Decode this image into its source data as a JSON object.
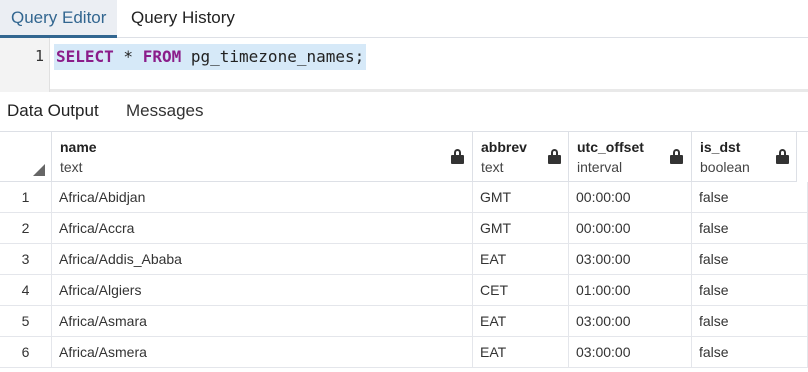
{
  "top_tabs": [
    {
      "label": "Query Editor",
      "active": true
    },
    {
      "label": "Query History",
      "active": false
    }
  ],
  "editor": {
    "line_number": "1",
    "tokens": [
      {
        "text": "SELECT",
        "kind": "keyword"
      },
      {
        "text": " * ",
        "kind": "plain"
      },
      {
        "text": "FROM",
        "kind": "keyword"
      },
      {
        "text": " pg_timezone_names;",
        "kind": "plain"
      }
    ]
  },
  "output_tabs": [
    {
      "label": "Data Output",
      "active": true
    },
    {
      "label": "Messages",
      "active": false
    }
  ],
  "grid": {
    "columns": [
      {
        "name": "name",
        "type": "text",
        "locked": true
      },
      {
        "name": "abbrev",
        "type": "text",
        "locked": true
      },
      {
        "name": "utc_offset",
        "type": "interval",
        "locked": true
      },
      {
        "name": "is_dst",
        "type": "boolean",
        "locked": true
      }
    ],
    "rows": [
      {
        "num": "1",
        "cells": [
          "Africa/Abidjan",
          "GMT",
          "00:00:00",
          "false"
        ]
      },
      {
        "num": "2",
        "cells": [
          "Africa/Accra",
          "GMT",
          "00:00:00",
          "false"
        ]
      },
      {
        "num": "3",
        "cells": [
          "Africa/Addis_Ababa",
          "EAT",
          "03:00:00",
          "false"
        ]
      },
      {
        "num": "4",
        "cells": [
          "Africa/Algiers",
          "CET",
          "01:00:00",
          "false"
        ]
      },
      {
        "num": "5",
        "cells": [
          "Africa/Asmara",
          "EAT",
          "03:00:00",
          "false"
        ]
      },
      {
        "num": "6",
        "cells": [
          "Africa/Asmera",
          "EAT",
          "03:00:00",
          "false"
        ]
      }
    ]
  },
  "colors": {
    "accent": "#326690",
    "keyword": "#8b1d8a",
    "selection": "#d6e9f8"
  },
  "icons": {
    "column_lock": "lock-icon",
    "sort_corner": "corner-triangle-icon"
  }
}
